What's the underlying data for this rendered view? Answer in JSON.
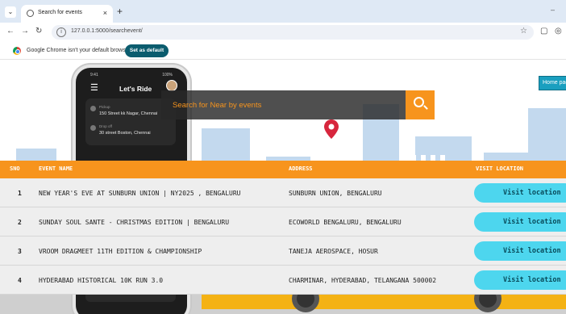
{
  "browser": {
    "tab_title": "Search for events",
    "tab_close": "×",
    "new_tab": "+",
    "tab_list": "⌄",
    "minimize": "–",
    "url": "127.0.0.1:5000/searchevent/",
    "infobar_text": "Google Chrome isn't your default browser",
    "set_default_label": "Set as default"
  },
  "phone": {
    "status_left": "9:41",
    "status_right": "100%",
    "app_title": "Let's Ride",
    "pickup_label": "Pickup",
    "pickup_address": "150 Street kk Nagar, Chennai",
    "dropoff_label": "Drop off",
    "dropoff_address": "30 street Boston, Chennai"
  },
  "search": {
    "placeholder": "Search for Near by events"
  },
  "home_button_label": "Home page",
  "table": {
    "headers": {
      "sno": "SNO",
      "event_name": "EVENT NAME",
      "address": "ADDRESS",
      "visit_location": "VISIT LOCATION"
    },
    "rows": [
      {
        "sno": "1",
        "event_name": "NEW YEAR'S EVE AT SUNBURN UNION | NY2025 , BENGALURU",
        "address": "SUNBURN UNION, BENGALURU",
        "action": "Visit location"
      },
      {
        "sno": "2",
        "event_name": "SUNDAY SOUL SANTE - CHRISTMAS EDITION | BENGALURU",
        "address": "ECOWORLD BENGALURU, BENGALURU",
        "action": "Visit location"
      },
      {
        "sno": "3",
        "event_name": "VROOM DRAGMEET 11TH EDITION & CHAMPIONSHIP",
        "address": "TANEJA AEROSPACE, HOSUR",
        "action": "Visit location"
      },
      {
        "sno": "4",
        "event_name": "HYDERABAD HISTORICAL 10K RUN 3.0",
        "address": "CHARMINAR, HYDERABAD, TELANGANA 500002",
        "action": "Visit location"
      }
    ]
  },
  "colors": {
    "accent_orange": "#f7941d",
    "visit_button": "#4dd6ee",
    "home_button": "#1a9fbf",
    "pin_red": "#d7263d"
  }
}
